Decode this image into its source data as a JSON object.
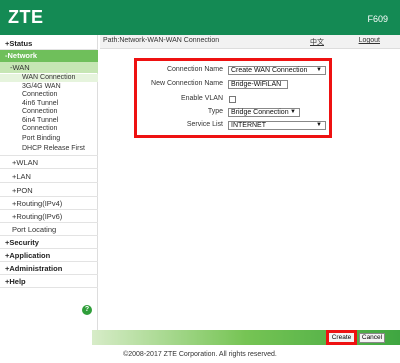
{
  "header": {
    "brand": "ZTE",
    "model": "F609"
  },
  "topbar": {
    "path": "Path:Network-WAN-WAN Connection",
    "language": "中文",
    "logout": "Logout"
  },
  "sidebar": {
    "status": "+Status",
    "network": "-Network",
    "wan": "-WAN",
    "wan_items": [
      "WAN Connection",
      "3G/4G WAN",
      "Connection",
      "4in6 Tunnel",
      "Connection",
      "6in4 Tunnel",
      "Connection",
      "Port Binding",
      "DHCP Release First"
    ],
    "network_items": [
      "+WLAN",
      "+LAN",
      "+PON",
      "+Routing(IPv4)",
      "+Routing(IPv6)",
      "Port Locating"
    ],
    "bottom_items": [
      "+Security",
      "+Application",
      "+Administration",
      "+Help"
    ],
    "help_icon": "?"
  },
  "form": {
    "connection_name_label": "Connection Name",
    "connection_name_value": "Create WAN Connection",
    "new_connection_name_label": "New Connection Name",
    "new_connection_name_value": "Bridge-WiFiLAN",
    "enable_vlan_label": "Enable VLAN",
    "type_label": "Type",
    "type_value": "Bridge Connection",
    "service_list_label": "Service List",
    "service_list_value": "INTERNET"
  },
  "buttons": {
    "create": "Create",
    "cancel": "Cancel"
  },
  "footer": {
    "copyright": "©2008-2017 ZTE Corporation. All rights reserved."
  },
  "colors": {
    "header_green": "#148a54",
    "nav_green": "#6fbf5b",
    "highlight_red": "#e11111"
  }
}
